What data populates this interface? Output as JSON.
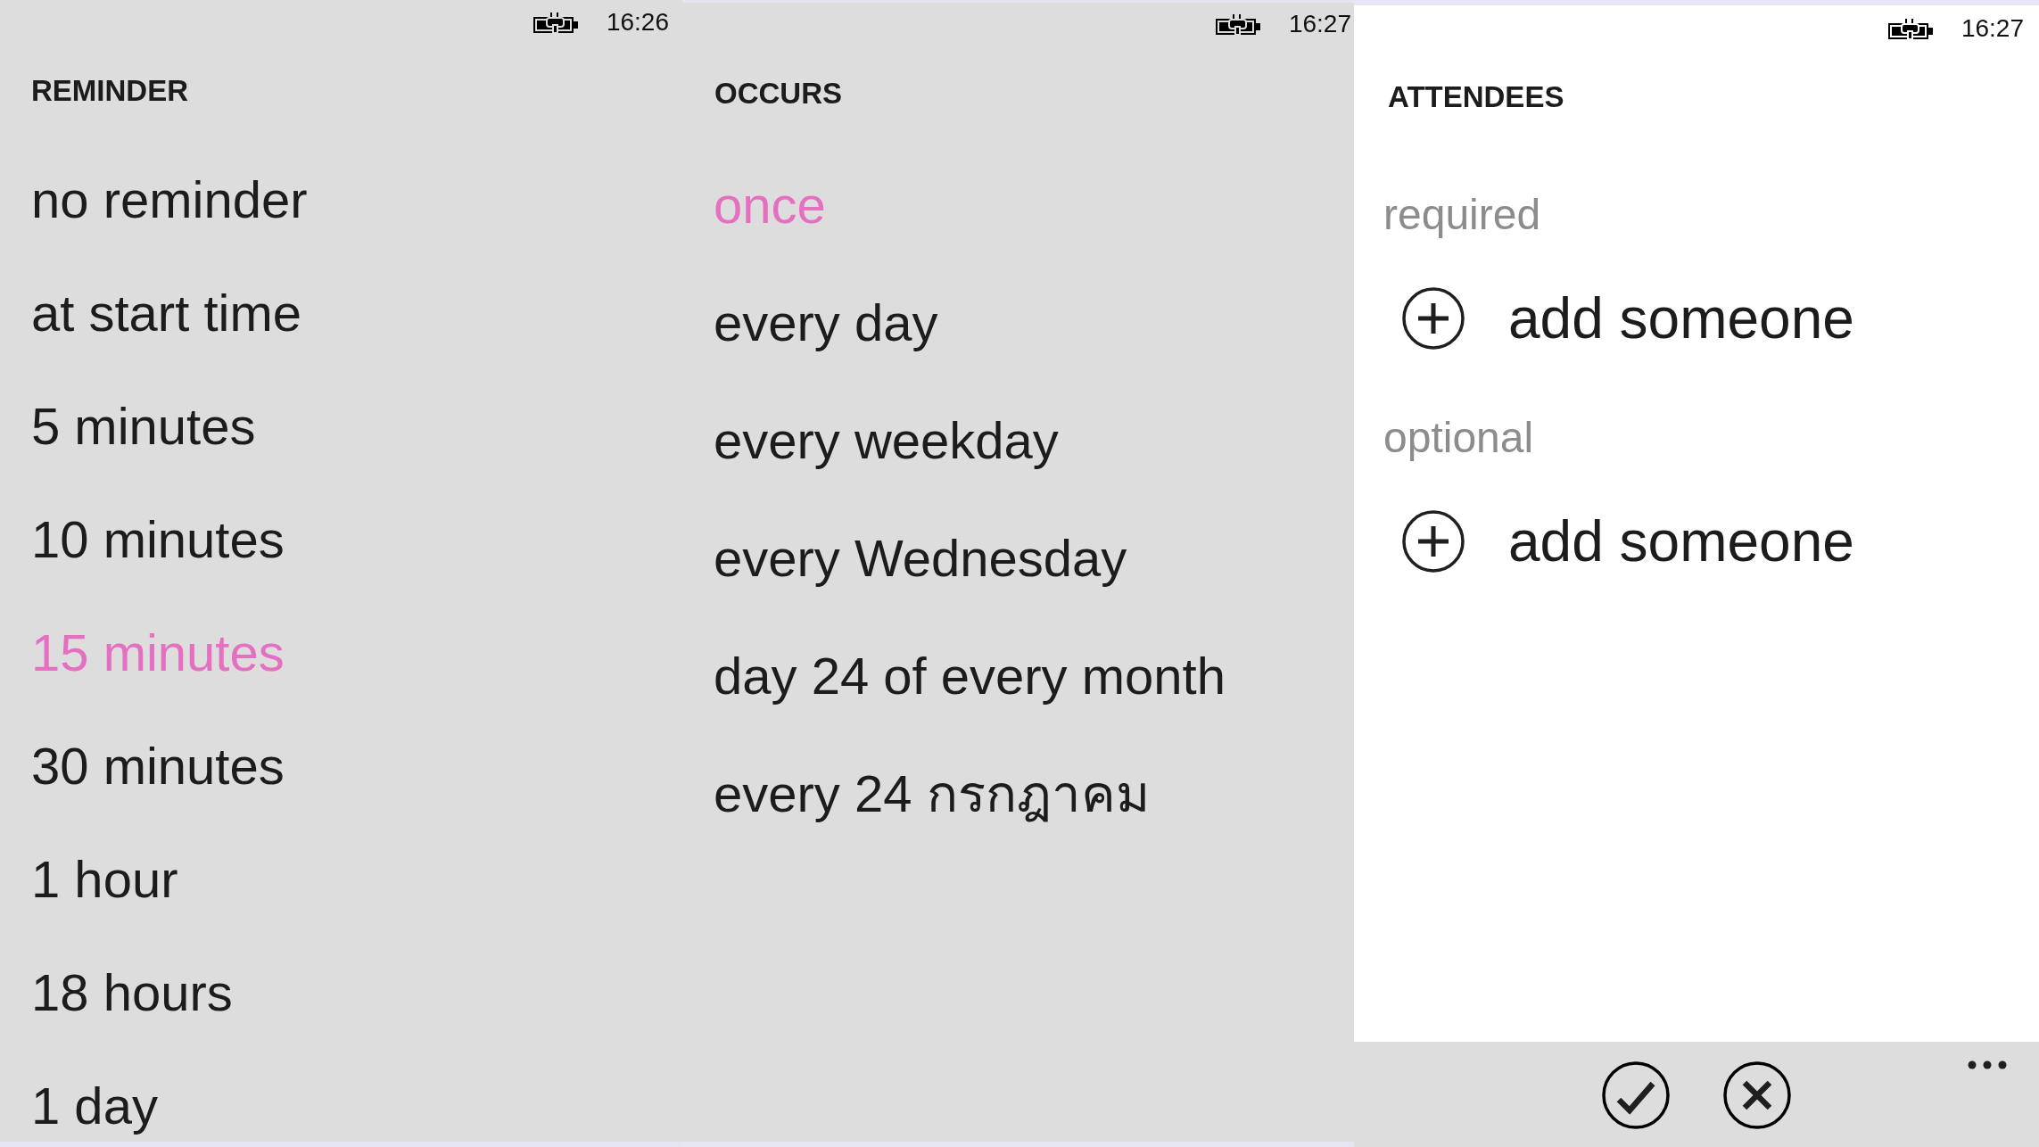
{
  "reminder_screen": {
    "status_bar": {
      "time": "16:26"
    },
    "title": "REMINDER",
    "options": [
      {
        "label": "no reminder",
        "selected": false
      },
      {
        "label": "at start time",
        "selected": false
      },
      {
        "label": "5 minutes",
        "selected": false
      },
      {
        "label": "10 minutes",
        "selected": false
      },
      {
        "label": "15 minutes",
        "selected": true
      },
      {
        "label": "30 minutes",
        "selected": false
      },
      {
        "label": "1 hour",
        "selected": false
      },
      {
        "label": "18 hours",
        "selected": false
      },
      {
        "label": "1 day",
        "selected": false
      }
    ]
  },
  "occurs_screen": {
    "status_bar": {
      "time": "16:27"
    },
    "title": "OCCURS",
    "options": [
      {
        "label": "once",
        "selected": true
      },
      {
        "label": "every day",
        "selected": false
      },
      {
        "label": "every weekday",
        "selected": false
      },
      {
        "label": "every Wednesday",
        "selected": false
      },
      {
        "label": "day 24 of every month",
        "selected": false
      },
      {
        "label": "every 24 กรกฎาคม",
        "selected": false
      }
    ]
  },
  "attendees_screen": {
    "status_bar": {
      "time": "16:27"
    },
    "title": "ATTENDEES",
    "groups": [
      {
        "label": "required",
        "add_button": "add someone"
      },
      {
        "label": "optional",
        "add_button": "add someone"
      }
    ]
  }
}
